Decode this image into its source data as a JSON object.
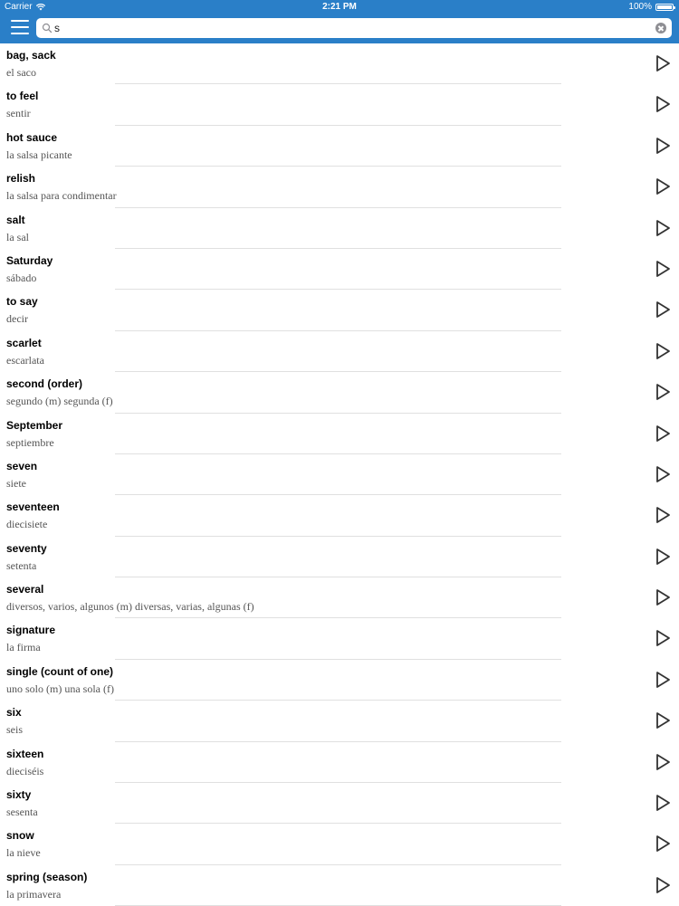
{
  "status_bar": {
    "carrier": "Carrier",
    "time": "2:21 PM",
    "battery": "100%"
  },
  "search": {
    "value": "s",
    "placeholder": ""
  },
  "entries": [
    {
      "en": "bag, sack",
      "es": "el saco"
    },
    {
      "en": "to feel",
      "es": "sentir"
    },
    {
      "en": "hot sauce",
      "es": "la salsa picante"
    },
    {
      "en": "relish",
      "es": "la salsa para condimentar"
    },
    {
      "en": "salt",
      "es": "la sal"
    },
    {
      "en": "Saturday",
      "es": "sábado"
    },
    {
      "en": "to say",
      "es": "decir"
    },
    {
      "en": "scarlet",
      "es": "escarlata"
    },
    {
      "en": "second (order)",
      "es": "segundo (m)  segunda (f)"
    },
    {
      "en": "September",
      "es": "septiembre"
    },
    {
      "en": "seven",
      "es": "siete"
    },
    {
      "en": "seventeen",
      "es": "diecisiete"
    },
    {
      "en": "seventy",
      "es": "setenta"
    },
    {
      "en": "several",
      "es": "diversos, varios, algunos (m)  diversas, varias, algunas (f)"
    },
    {
      "en": "signature",
      "es": "la firma"
    },
    {
      "en": "single (count of one)",
      "es": "uno solo (m)  una sola (f)"
    },
    {
      "en": "six",
      "es": "seis"
    },
    {
      "en": "sixteen",
      "es": "dieciséis"
    },
    {
      "en": "sixty",
      "es": "sesenta"
    },
    {
      "en": "snow",
      "es": "la nieve"
    },
    {
      "en": "spring (season)",
      "es": "la primavera"
    }
  ],
  "icons": {
    "menu": "hamburger-menu-icon",
    "search": "magnifier-icon",
    "clear": "clear-x-icon",
    "play": "play-triangle-icon",
    "wifi": "wifi-icon",
    "battery": "battery-icon"
  },
  "colors": {
    "nav_background": "#2a7fc8",
    "primary_text": "#000000",
    "secondary_text": "#555555",
    "separator": "#e0e0e0",
    "play_icon": "#333333"
  }
}
